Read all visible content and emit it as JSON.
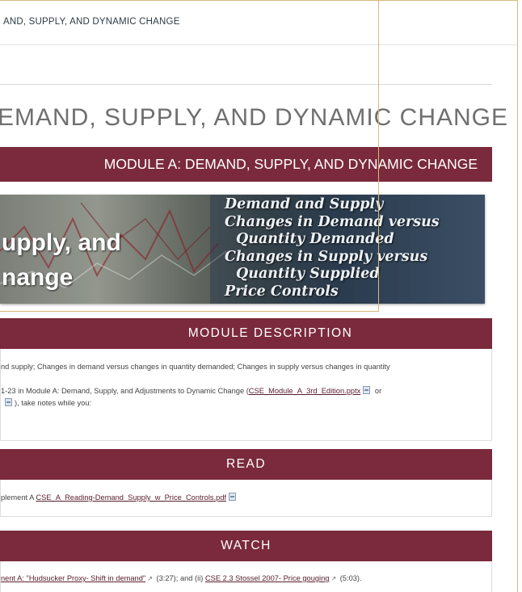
{
  "breadcrumb": "AND, SUPPLY, AND DYNAMIC CHANGE",
  "page_title": "EMAND, SUPPLY, AND DYNAMIC CHANGE",
  "module_banner": "MODULE A: DEMAND, SUPPLY, AND DYNAMIC CHANGE",
  "hero": {
    "big_line_1": "upply, and",
    "big_line_2": "nange",
    "topics": [
      "Demand and Supply",
      "Changes in Demand versus",
      "Quantity Demanded",
      "Changes in Supply versus",
      "Quantity Supplied",
      "Price Controls"
    ]
  },
  "sections": {
    "description": {
      "heading": "MODULE DESCRIPTION",
      "line1": "nd supply; Changes in demand versus changes in quantity demanded; Changes in supply versus changes in quantity",
      "line2_prefix": "1-23 in Module A: Demand, Supply, and Adjustments to Dynamic Change (",
      "line2_link": "CSE_Module_A_3rd_Edition.pptx",
      "line2_suffix": " or",
      "line3_suffix": "), take notes while you:"
    },
    "read": {
      "heading": "READ",
      "prefix": "plement A ",
      "link": "CSE_A_Reading-Demand_Supply_w_Price_Controls.pdf"
    },
    "watch": {
      "heading": "WATCH",
      "link1": "nent A: \"Hudsucker Proxy- Shift in demand\"",
      "mid": " (3:27); and (ii) ",
      "link2": "CSE 2.3 Stossel 2007- Price gouging",
      "end": " (5:03)."
    }
  },
  "colors": {
    "banner": "#7a2a3c",
    "title_text": "#6f6f6f",
    "frame_border": "#d9b97a"
  }
}
